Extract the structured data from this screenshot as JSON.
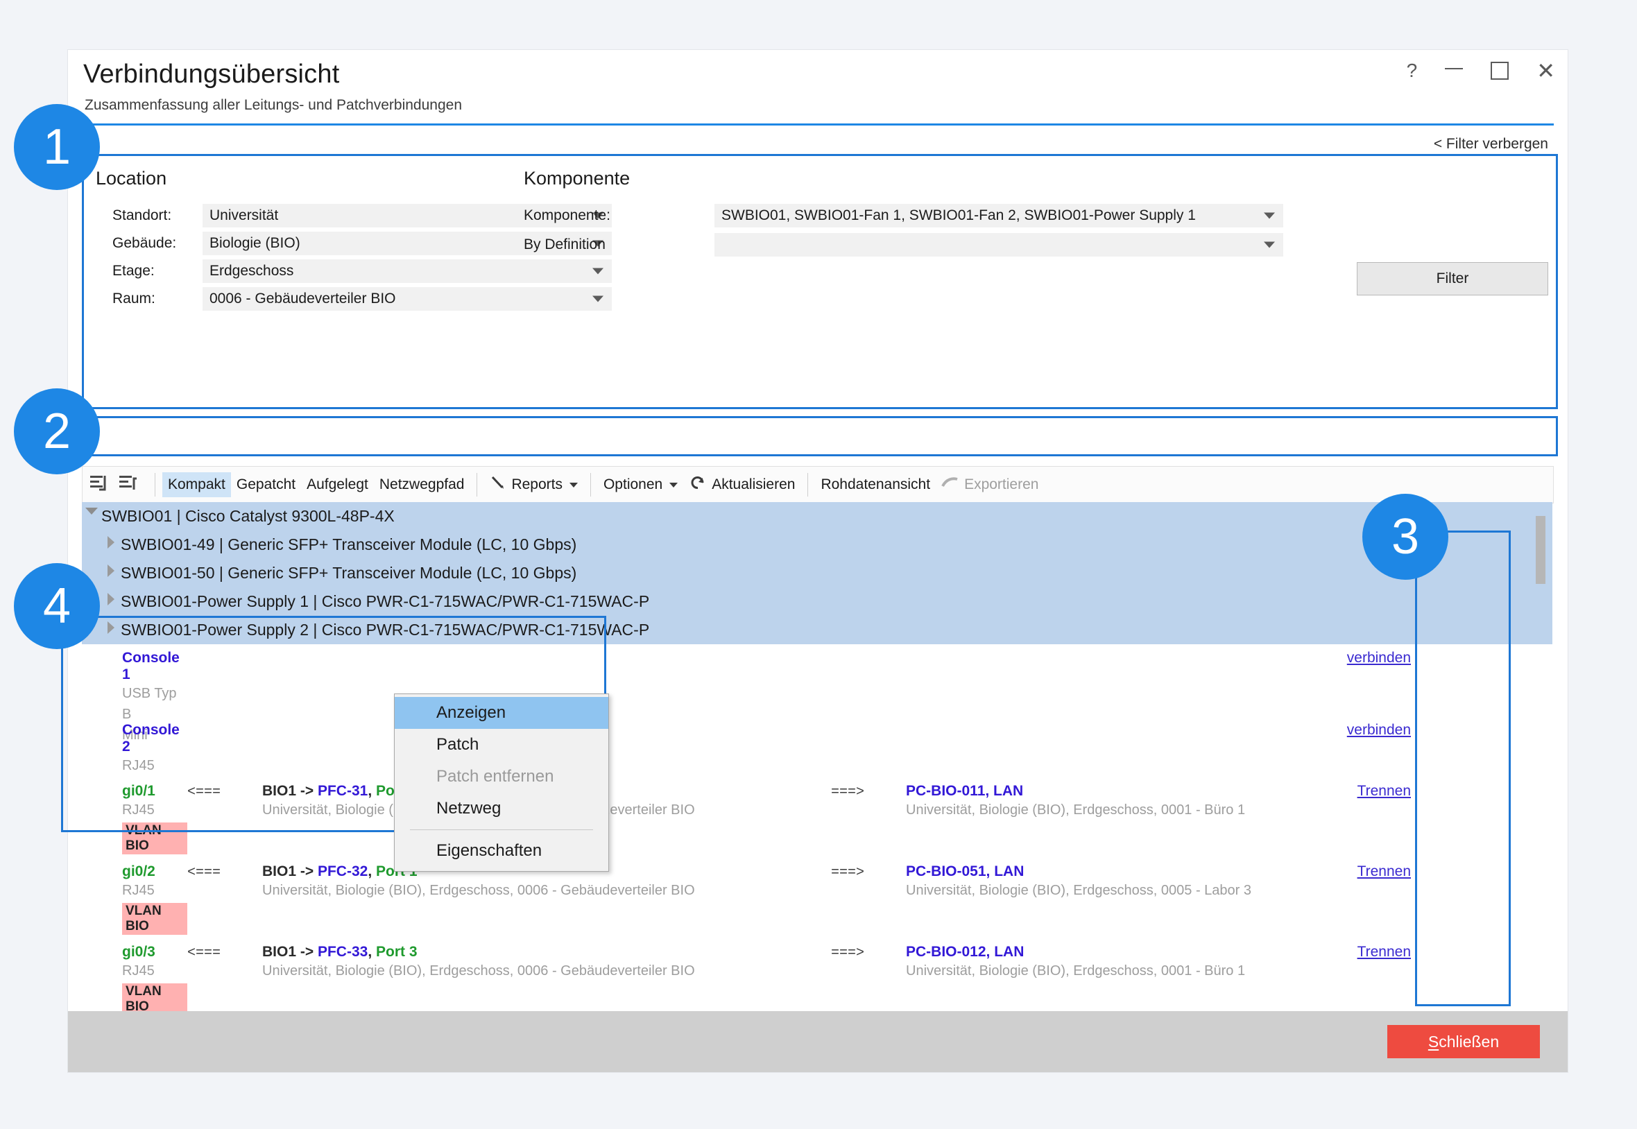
{
  "window": {
    "title": "Verbindungsübersicht",
    "subtitle": "Zusammenfassung aller Leitungs- und Patchverbindungen",
    "controls": {
      "help": "?",
      "minimize": "—",
      "maximize": "□",
      "close": "✕"
    }
  },
  "filter": {
    "hide_link": "< Filter verbergen",
    "location_group": "Location",
    "component_group": "Komponente",
    "location_fields": [
      {
        "label": "Standort:",
        "value": "Universität"
      },
      {
        "label": "Gebäude:",
        "value": "Biologie (BIO)"
      },
      {
        "label": "Etage:",
        "value": "Erdgeschoss"
      },
      {
        "label": "Raum:",
        "value": "0006 - Gebäudeverteiler BIO"
      }
    ],
    "component_fields": [
      {
        "label": "Komponente:",
        "value": "SWBIO01, SWBIO01-Fan 1, SWBIO01-Fan 2, SWBIO01-Power Supply 1"
      },
      {
        "label": "By Definition",
        "value": ""
      }
    ],
    "filter_button": "Filter"
  },
  "toolbar": {
    "icons": [
      "align-list-left-icon",
      "align-list-right-icon"
    ],
    "items": [
      {
        "label": "Kompakt",
        "state": "active"
      },
      {
        "label": "Gepatcht",
        "state": "normal"
      },
      {
        "label": "Aufgelegt",
        "state": "normal"
      },
      {
        "label": "Netzwegpfad",
        "state": "normal"
      },
      {
        "label": "Reports",
        "state": "normal",
        "icon": "pen-icon",
        "caret": true
      },
      {
        "label": "Optionen",
        "state": "normal",
        "caret": true
      },
      {
        "label": "Aktualisieren",
        "state": "normal",
        "icon": "refresh-icon"
      },
      {
        "label": "Rohdatenansicht",
        "state": "normal"
      },
      {
        "label": "Exportieren",
        "state": "disabled",
        "icon": "export-icon"
      }
    ]
  },
  "tree": {
    "nodes": [
      {
        "label": "SWBIO01 | Cisco Catalyst 9300L-48P-4X",
        "expander": "down",
        "selected": true
      },
      {
        "label": "SWBIO01-49 | Generic SFP+ Transceiver Module (LC, 10 Gbps)",
        "expander": "right",
        "selected": true
      },
      {
        "label": "SWBIO01-50 | Generic SFP+ Transceiver Module (LC, 10 Gbps)",
        "expander": "right",
        "selected": true
      },
      {
        "label": "SWBIO01-Power Supply 1 | Cisco PWR-C1-715WAC/PWR-C1-715WAC-P",
        "expander": "right",
        "selected": true
      },
      {
        "label": "SWBIO01-Power Supply 2 | Cisco PWR-C1-715WAC/PWR-C1-715WAC-P",
        "expander": "right",
        "selected": true
      }
    ],
    "rows": [
      {
        "port": "Console 1",
        "port_color": "blue",
        "connector": "USB Typ B",
        "connector2": "Mini",
        "vlan": "",
        "left_arrow": "",
        "mid_line1": "",
        "mid_line1_pfc": "",
        "mid_line1_port": "",
        "mid_line2": "",
        "right_arrow": "",
        "right_line1": "",
        "right_line2": "",
        "action": "verbinden",
        "highlight": true
      },
      {
        "port": "Console 2",
        "port_color": "blue",
        "connector": "RJ45",
        "connector2": "",
        "vlan": "",
        "left_arrow": "",
        "mid_line1": "",
        "mid_line1_pfc": "",
        "mid_line1_port": "",
        "mid_line2": "",
        "right_arrow": "",
        "right_line1": "",
        "right_line2": "",
        "action": "verbinden",
        "highlight": false
      },
      {
        "port": "gi0/1",
        "port_color": "green",
        "connector": "RJ45",
        "connector2": "",
        "vlan": "VLAN BIO",
        "left_arrow": "<===",
        "mid_prefix": "BIO1 -> ",
        "mid_line1_pfc": "PFC-31",
        "mid_line1_port": "Port 2",
        "mid_line2": "Universität, Biologie (BIO), Erdgeschoss, 0006 - Gebäudeverteiler BIO",
        "right_arrow": "===>",
        "right_line1": "PC-BIO-011, LAN",
        "right_line2": "Universität, Biologie (BIO), Erdgeschoss, 0001 - Büro 1",
        "action": "Trennen",
        "highlight": false
      },
      {
        "port": "gi0/2",
        "port_color": "green",
        "connector": "RJ45",
        "connector2": "",
        "vlan": "VLAN BIO",
        "left_arrow": "<===",
        "mid_prefix": "BIO1 -> ",
        "mid_line1_pfc": "PFC-32",
        "mid_line1_port": "Port 1",
        "mid_line2": "Universität, Biologie (BIO), Erdgeschoss, 0006 - Gebäudeverteiler BIO",
        "right_arrow": "===>",
        "right_line1": "PC-BIO-051, LAN",
        "right_line2": "Universität, Biologie (BIO), Erdgeschoss, 0005 - Labor 3",
        "action": "Trennen",
        "highlight": false
      },
      {
        "port": "gi0/3",
        "port_color": "green",
        "connector": "RJ45",
        "connector2": "",
        "vlan": "VLAN BIO",
        "left_arrow": "<===",
        "mid_prefix": "BIO1 -> ",
        "mid_line1_pfc": "PFC-33",
        "mid_line1_port": "Port 3",
        "mid_line2": "Universität, Biologie (BIO), Erdgeschoss, 0006 - Gebäudeverteiler BIO",
        "right_arrow": "===>",
        "right_line1": "PC-BIO-012, LAN",
        "right_line2": "Universität, Biologie (BIO), Erdgeschoss, 0001 - Büro 1",
        "action": "Trennen",
        "highlight": false
      }
    ]
  },
  "context_menu": {
    "items": [
      {
        "label": "Anzeigen",
        "state": "selected"
      },
      {
        "label": "Patch",
        "state": "normal"
      },
      {
        "label": "Patch entfernen",
        "state": "disabled"
      },
      {
        "label": "Netzweg",
        "state": "normal"
      },
      {
        "label": "__separator__",
        "state": "separator"
      },
      {
        "label": "Eigenschaften",
        "state": "normal"
      }
    ]
  },
  "footer": {
    "close_accesskey": "S",
    "close_rest": "chließen"
  },
  "annotations": {
    "badges": [
      {
        "number": "1"
      },
      {
        "number": "2"
      },
      {
        "number": "3"
      },
      {
        "number": "4"
      }
    ],
    "color": "#1e87e5"
  }
}
